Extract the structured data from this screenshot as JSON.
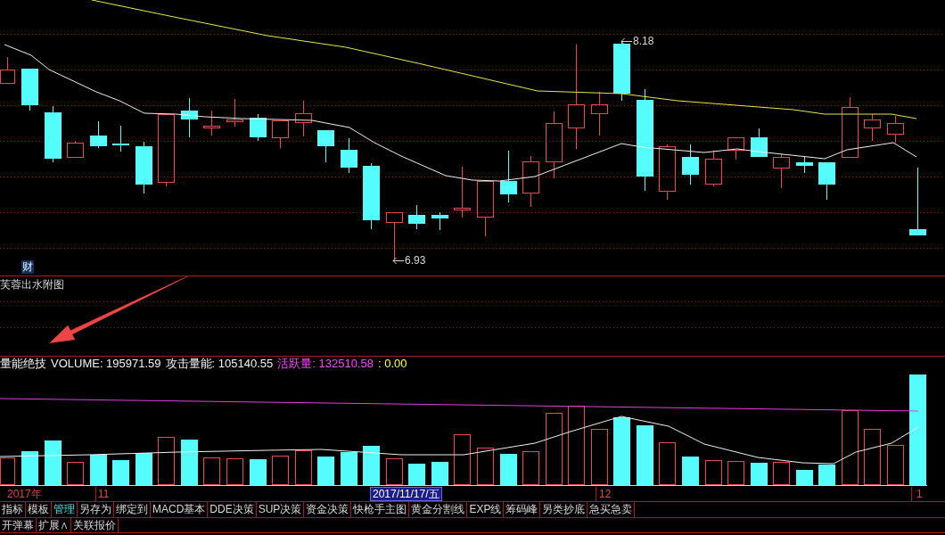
{
  "main_chart": {
    "info_tag": "财",
    "high_marker": "8.18",
    "low_marker": "6.93"
  },
  "sub_chart": {
    "title": "芙蓉出水附图"
  },
  "volume_chart": {
    "legend": [
      {
        "text": "量能绝技",
        "color": "#f0f0f0"
      },
      {
        "text": "VOLUME: 195971.59",
        "color": "#f0f0f0"
      },
      {
        "text": "攻击量能: 105140.55",
        "color": "#f0f0f0"
      },
      {
        "text": "活跃量: 132510.58",
        "color": "#ff44ff"
      },
      {
        "text": ": 0.00",
        "color": "#ffff44"
      }
    ]
  },
  "time_axis": {
    "labels": [
      "2017年",
      "11",
      "12",
      "1"
    ],
    "cursor_date": "2017/11/17/五"
  },
  "toolbar": {
    "tabs": [
      {
        "label": "指标",
        "selected": false
      },
      {
        "label": "模板",
        "selected": false
      },
      {
        "label": "管理",
        "selected": true
      },
      {
        "label": "另存为",
        "selected": false
      },
      {
        "label": "绑定到",
        "selected": false
      },
      {
        "label": "MACD基本",
        "selected": false
      },
      {
        "label": "DDE决策",
        "selected": false
      },
      {
        "label": "SUP决策",
        "selected": false
      },
      {
        "label": "资金决策",
        "selected": false
      },
      {
        "label": "快枪手主图",
        "selected": false
      },
      {
        "label": "黄金分割线",
        "selected": false
      },
      {
        "label": "EXP线",
        "selected": false
      },
      {
        "label": "筹码峰",
        "selected": false
      },
      {
        "label": "另类抄底",
        "selected": false
      },
      {
        "label": "急买急卖",
        "selected": false
      }
    ]
  },
  "bottom_bar": {
    "buttons": [
      "开弹幕",
      "扩展∧",
      "关联报价"
    ]
  }
}
